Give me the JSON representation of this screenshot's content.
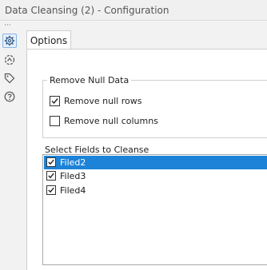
{
  "window": {
    "title": "Data Cleansing (2) - Configuration"
  },
  "sidebar": {
    "items": [
      {
        "icon": "gear-icon",
        "active": true
      },
      {
        "icon": "connection-icon",
        "active": false
      },
      {
        "icon": "tag-icon",
        "active": false
      },
      {
        "icon": "help-icon",
        "active": false
      }
    ]
  },
  "tabs": [
    {
      "label": "Options",
      "active": true
    }
  ],
  "remove_null": {
    "legend": "Remove Null Data",
    "rows_label": "Remove null rows",
    "rows_checked": true,
    "columns_label": "Remove null columns",
    "columns_checked": false
  },
  "fields": {
    "label": "Select Fields to Cleanse",
    "items": [
      {
        "label": "Filed2",
        "checked": true,
        "selected": true
      },
      {
        "label": "Filed3",
        "checked": true,
        "selected": false
      },
      {
        "label": "Filed4",
        "checked": true,
        "selected": false
      }
    ]
  },
  "colors": {
    "selection": "#1c83d8",
    "accent": "#3a7fc4"
  }
}
